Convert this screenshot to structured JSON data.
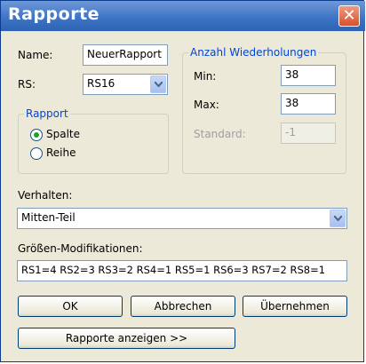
{
  "window": {
    "title": "Rapporte",
    "close_symbol": "✕"
  },
  "name": {
    "label": "Name:",
    "value": "NeuerRapport"
  },
  "rs": {
    "label": "RS:",
    "value": "RS16"
  },
  "rapport_group": {
    "title": "Rapport",
    "options": [
      "Spalte",
      "Reihe"
    ],
    "selected": "Spalte"
  },
  "wiederholungen": {
    "title": "Anzahl Wiederholungen",
    "min_label": "Min:",
    "min_value": "38",
    "max_label": "Max:",
    "max_value": "38",
    "standard_label": "Standard:",
    "standard_value": "-1"
  },
  "verhalten": {
    "label": "Verhalten:",
    "value": "Mitten-Teil"
  },
  "groessen": {
    "label": "Größen-Modifikationen:",
    "value": "RS1=4  RS2=3  RS3=2  RS4=1  RS5=1  RS6=3  RS7=2  RS8=1"
  },
  "buttons": {
    "ok": "OK",
    "cancel": "Abbrechen",
    "apply": "Übernehmen",
    "show": "Rapporte anzeigen >>"
  }
}
